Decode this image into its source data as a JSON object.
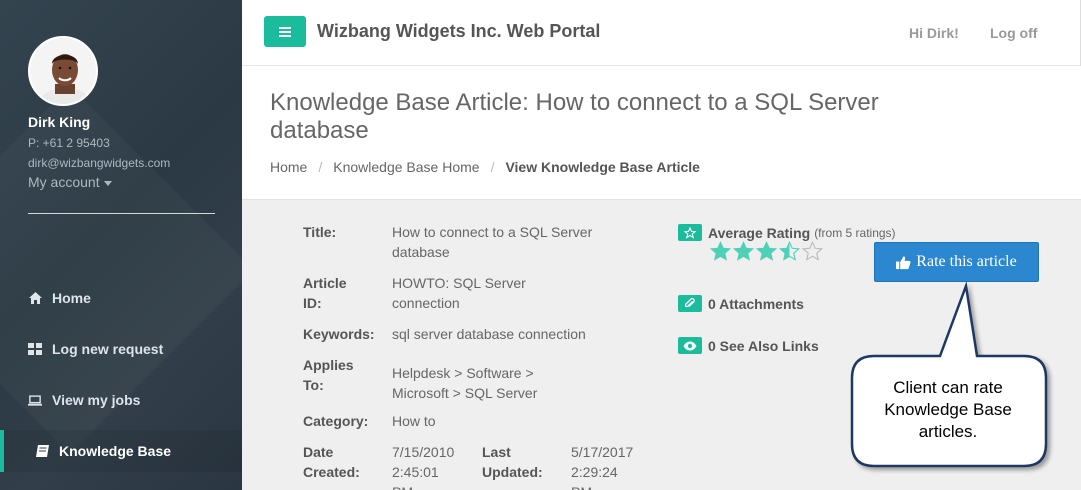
{
  "sidebar": {
    "user": {
      "name": "Dirk King",
      "phone": "P: +61 2 95403",
      "email": "dirk@wizbangwidgets.com",
      "account_label": "My account"
    },
    "nav": [
      {
        "label": "Home",
        "icon": "home-icon"
      },
      {
        "label": "Log new request",
        "icon": "grid-icon"
      },
      {
        "label": "View my jobs",
        "icon": "laptop-icon"
      },
      {
        "label": "Knowledge Base",
        "icon": "book-icon",
        "active": true
      }
    ]
  },
  "topbar": {
    "title": "Wizbang Widgets Inc. Web Portal",
    "greeting": "Hi Dirk!",
    "logoff": "Log off"
  },
  "page": {
    "title": "Knowledge Base Article: How to connect to a SQL Server database",
    "breadcrumb": [
      "Home",
      "Knowledge Base Home",
      "View Knowledge Base Article"
    ]
  },
  "article": {
    "title_label": "Title:",
    "title_value_1": "How to connect to a SQL Server",
    "title_value_2": "database",
    "id_label_1": "Article",
    "id_label_2": "ID:",
    "id_value_1": "HOWTO: SQL Server",
    "id_value_2": "connection",
    "keywords_label": "Keywords:",
    "keywords_value": "sql server database connection",
    "applies_label_1": "Applies",
    "applies_label_2": "To:",
    "applies_value_1": "Helpdesk > Software >",
    "applies_value_2": "Microsoft > SQL Server",
    "category_label": "Category:",
    "category_value": "How to",
    "date_created_label_1": "Date",
    "date_created_label_2": "Created:",
    "date_created_value_1": "7/15/2010",
    "date_created_value_2": "2:45:01",
    "date_created_value_3": "PM",
    "last_updated_label_1": "Last",
    "last_updated_label_2": "Updated:",
    "last_updated_value_1": "5/17/2017",
    "last_updated_value_2": "2:29:24",
    "last_updated_value_3": "PM"
  },
  "rating": {
    "label": "Average Rating",
    "from": "(from 5 ratings)",
    "value": 3.5,
    "max": 5,
    "star_color": "#4fd1b7"
  },
  "rate_button": {
    "label": "Rate this article",
    "color": "#2b88d0"
  },
  "attachments": {
    "label": "0 Attachments"
  },
  "see_also": {
    "label": "0 See Also Links"
  },
  "callout": {
    "line1": "Client can rate",
    "line2": "Knowledge Base",
    "line3": "articles."
  },
  "colors": {
    "accent": "#1abc9c",
    "sidebar": "#2f3d48"
  }
}
